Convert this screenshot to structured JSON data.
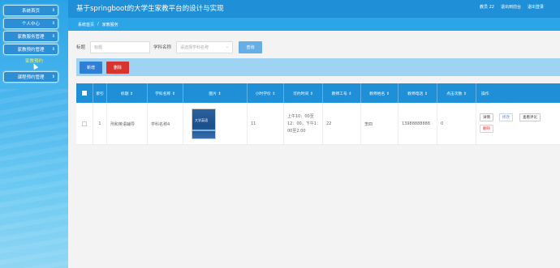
{
  "app": {
    "title": "基于springboot的大学生家教平台的设计与实现",
    "top_links": [
      "教员 22",
      "退出到前台",
      "退出登录"
    ]
  },
  "sidebar": {
    "items": [
      {
        "label": "系统首页"
      },
      {
        "label": "个人中心"
      },
      {
        "label": "家教服务管理"
      },
      {
        "label": "家教预约管理"
      }
    ],
    "sub_item": "家教预约",
    "last_item": "课程预约管理"
  },
  "breadcrumb": {
    "items": [
      "系统首页",
      "家教服务"
    ]
  },
  "search": {
    "title_label": "标题",
    "title_placeholder": "标题",
    "subject_label": "学科名称",
    "subject_placeholder": "请选择学科名称",
    "button": "查询"
  },
  "actions": {
    "add": "新增",
    "delete": "删除"
  },
  "table": {
    "headers": [
      "",
      "索引",
      "标题 ⇕",
      "学科名称 ⇕",
      "图片 ⇕",
      "小时学价 ⇕",
      "可约时间 ⇕",
      "教师工号 ⇕",
      "教师姓名 ⇕",
      "教师电话 ⇕",
      "点击次数 ⇕",
      "操作"
    ],
    "row": {
      "index": "1",
      "title": "刑和英语辅导",
      "subject": "学科名称4",
      "image_text": "大学英语",
      "hourly_price": "11",
      "available_time": "上午10：00至12：00，下午1：00至2:00",
      "teacher_id": "22",
      "teacher_name": "李四",
      "teacher_phone": "13988888888",
      "clicks": "0",
      "ops": {
        "detail": "详情",
        "edit": "修改",
        "comments": "查看评论",
        "delete": "删除"
      }
    }
  },
  "colors": {
    "header": "#1f8fd8",
    "sidebar": "#2aa3e6",
    "add_button": "#2f7fd6",
    "delete_button": "#d8332e",
    "sub_item": "#f7ef5a"
  }
}
